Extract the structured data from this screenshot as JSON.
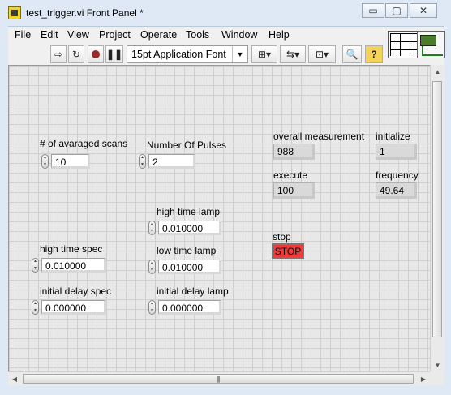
{
  "window": {
    "title": "test_trigger.vi Front Panel *",
    "minimize": "▭",
    "maximize": "▢",
    "close": "✕"
  },
  "menu": [
    "File",
    "Edit",
    "View",
    "Project",
    "Operate",
    "Tools",
    "Window",
    "Help"
  ],
  "toolbar": {
    "run_icon": "run-arrow-icon",
    "font": "15pt Application Font",
    "font_arrow": "▼",
    "help_glyph": "?",
    "search_glyph": "🔍"
  },
  "controls": {
    "averaged_scans": {
      "label": "# of avaraged scans",
      "value": "10"
    },
    "number_of_pulses": {
      "label": "Number Of Pulses",
      "value": "2"
    },
    "high_time_lamp": {
      "label": "high time lamp",
      "value": "0.010000"
    },
    "high_time_spec": {
      "label": "high time spec",
      "value": "0.010000"
    },
    "low_time_lamp": {
      "label": "low time lamp",
      "value": "0.010000"
    },
    "initial_delay_spec": {
      "label": "initial delay spec",
      "value": "0.000000"
    },
    "initial_delay_lamp": {
      "label": "initial delay lamp",
      "value": "0.000000"
    }
  },
  "indicators": {
    "overall_measurement": {
      "label": "overall measurement",
      "value": "988"
    },
    "initialize": {
      "label": "initialize",
      "value": "1"
    },
    "execute": {
      "label": "execute",
      "value": "100"
    },
    "frequency": {
      "label": "frequency",
      "value": "49.64"
    }
  },
  "stop": {
    "label": "stop",
    "button": "STOP"
  },
  "colors": {
    "stop_button": "#ee3b3b",
    "panel_bg": "#e8e8e8",
    "titlebar": "#dfe9f5"
  }
}
